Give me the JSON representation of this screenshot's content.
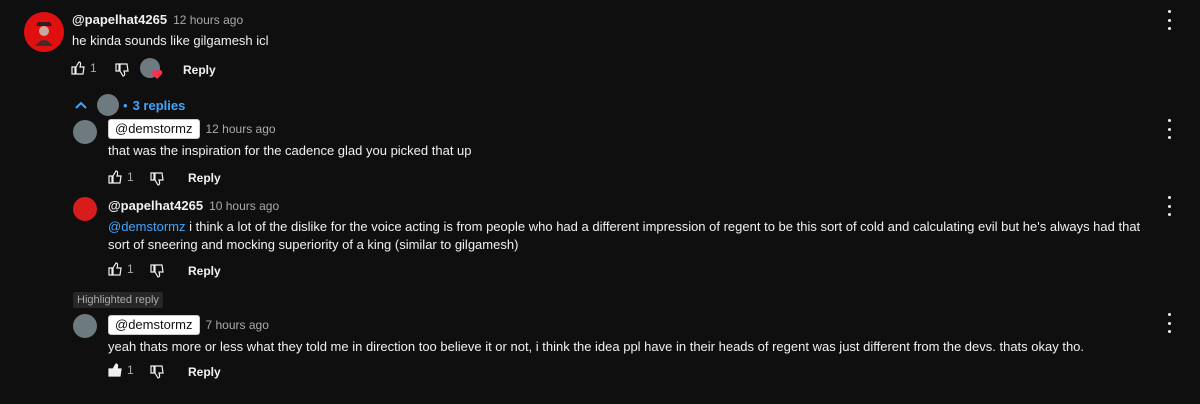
{
  "top_comment": {
    "author": "@papelhat4265",
    "time": "12 hours ago",
    "text": "he kinda sounds like gilgamesh icl",
    "likes": "1",
    "reply_label": "Reply"
  },
  "replies_toggle": {
    "label": "3 replies",
    "separator": "•"
  },
  "replies": [
    {
      "author": "@demstormz",
      "time": "12 hours ago",
      "text": "that was the inspiration for the cadence glad you picked that up",
      "likes": "1",
      "reply_label": "Reply"
    },
    {
      "author": "@papelhat4265",
      "time": "10 hours ago",
      "mention": "@demstormz",
      "text": " i think a lot of the dislike for the voice acting is from people who had a different impression of regent to be this sort of cold and calculating evil but he's always had that sort of sneering and mocking superiority of a king (similar to gilgamesh)",
      "likes": "1",
      "reply_label": "Reply"
    },
    {
      "highlight_label": "Highlighted reply",
      "author": "@demstormz",
      "time": "7 hours ago",
      "text": "yeah thats more or less what they told me in direction too believe it or not, i think the idea ppl have in their heads of regent was just different from the devs. thats okay tho.",
      "likes": "1",
      "reply_label": "Reply"
    }
  ],
  "colors": {
    "background": "#0f0f0f",
    "link": "#3ea6ff",
    "avatar_red": "#d81b1b"
  }
}
